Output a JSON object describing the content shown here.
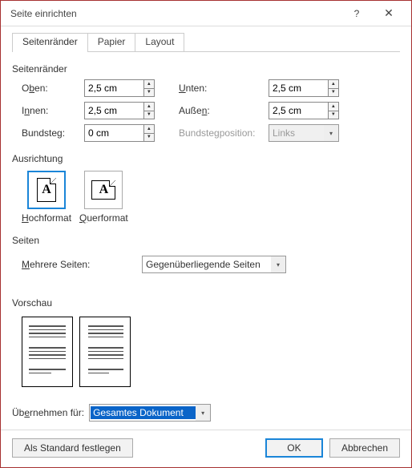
{
  "title": "Seite einrichten",
  "tabs": {
    "t0": "Seitenränder",
    "t1": "Papier",
    "t2": "Layout"
  },
  "margins": {
    "heading": "Seitenränder",
    "top_lbl_pre": "O",
    "top_lbl_ul": "b",
    "top_lbl_post": "en:",
    "top_val": "2,5 cm",
    "bottom_lbl_pre": "",
    "bottom_lbl_ul": "U",
    "bottom_lbl_post": "nten:",
    "bottom_val": "2,5 cm",
    "inner_lbl_pre": "I",
    "inner_lbl_ul": "n",
    "inner_lbl_post": "nen:",
    "inner_val": "2,5 cm",
    "outer_lbl_pre": "Auße",
    "outer_lbl_ul": "n",
    "outer_lbl_post": ":",
    "outer_val": "2,5 cm",
    "gutter_lbl": "Bundsteg:",
    "gutter_val": "0 cm",
    "gutterpos_lbl": "Bundstegposition:",
    "gutterpos_val": "Links"
  },
  "orientation": {
    "heading": "Ausrichtung",
    "portrait_pre": "",
    "portrait_ul": "H",
    "portrait_post": "ochformat",
    "landscape_pre": "",
    "landscape_ul": "Q",
    "landscape_post": "uerformat"
  },
  "pages": {
    "heading": "Seiten",
    "multi_pre": "",
    "multi_ul": "M",
    "multi_post": "ehrere Seiten:",
    "multi_val": "Gegenüberliegende Seiten"
  },
  "preview": {
    "heading": "Vorschau"
  },
  "apply": {
    "lbl_pre": "Üb",
    "lbl_ul": "e",
    "lbl_post": "rnehmen für:",
    "val": "Gesamtes Dokument"
  },
  "footer": {
    "default_btn": "Als Standard festlegen",
    "ok": "OK",
    "cancel": "Abbrechen"
  }
}
